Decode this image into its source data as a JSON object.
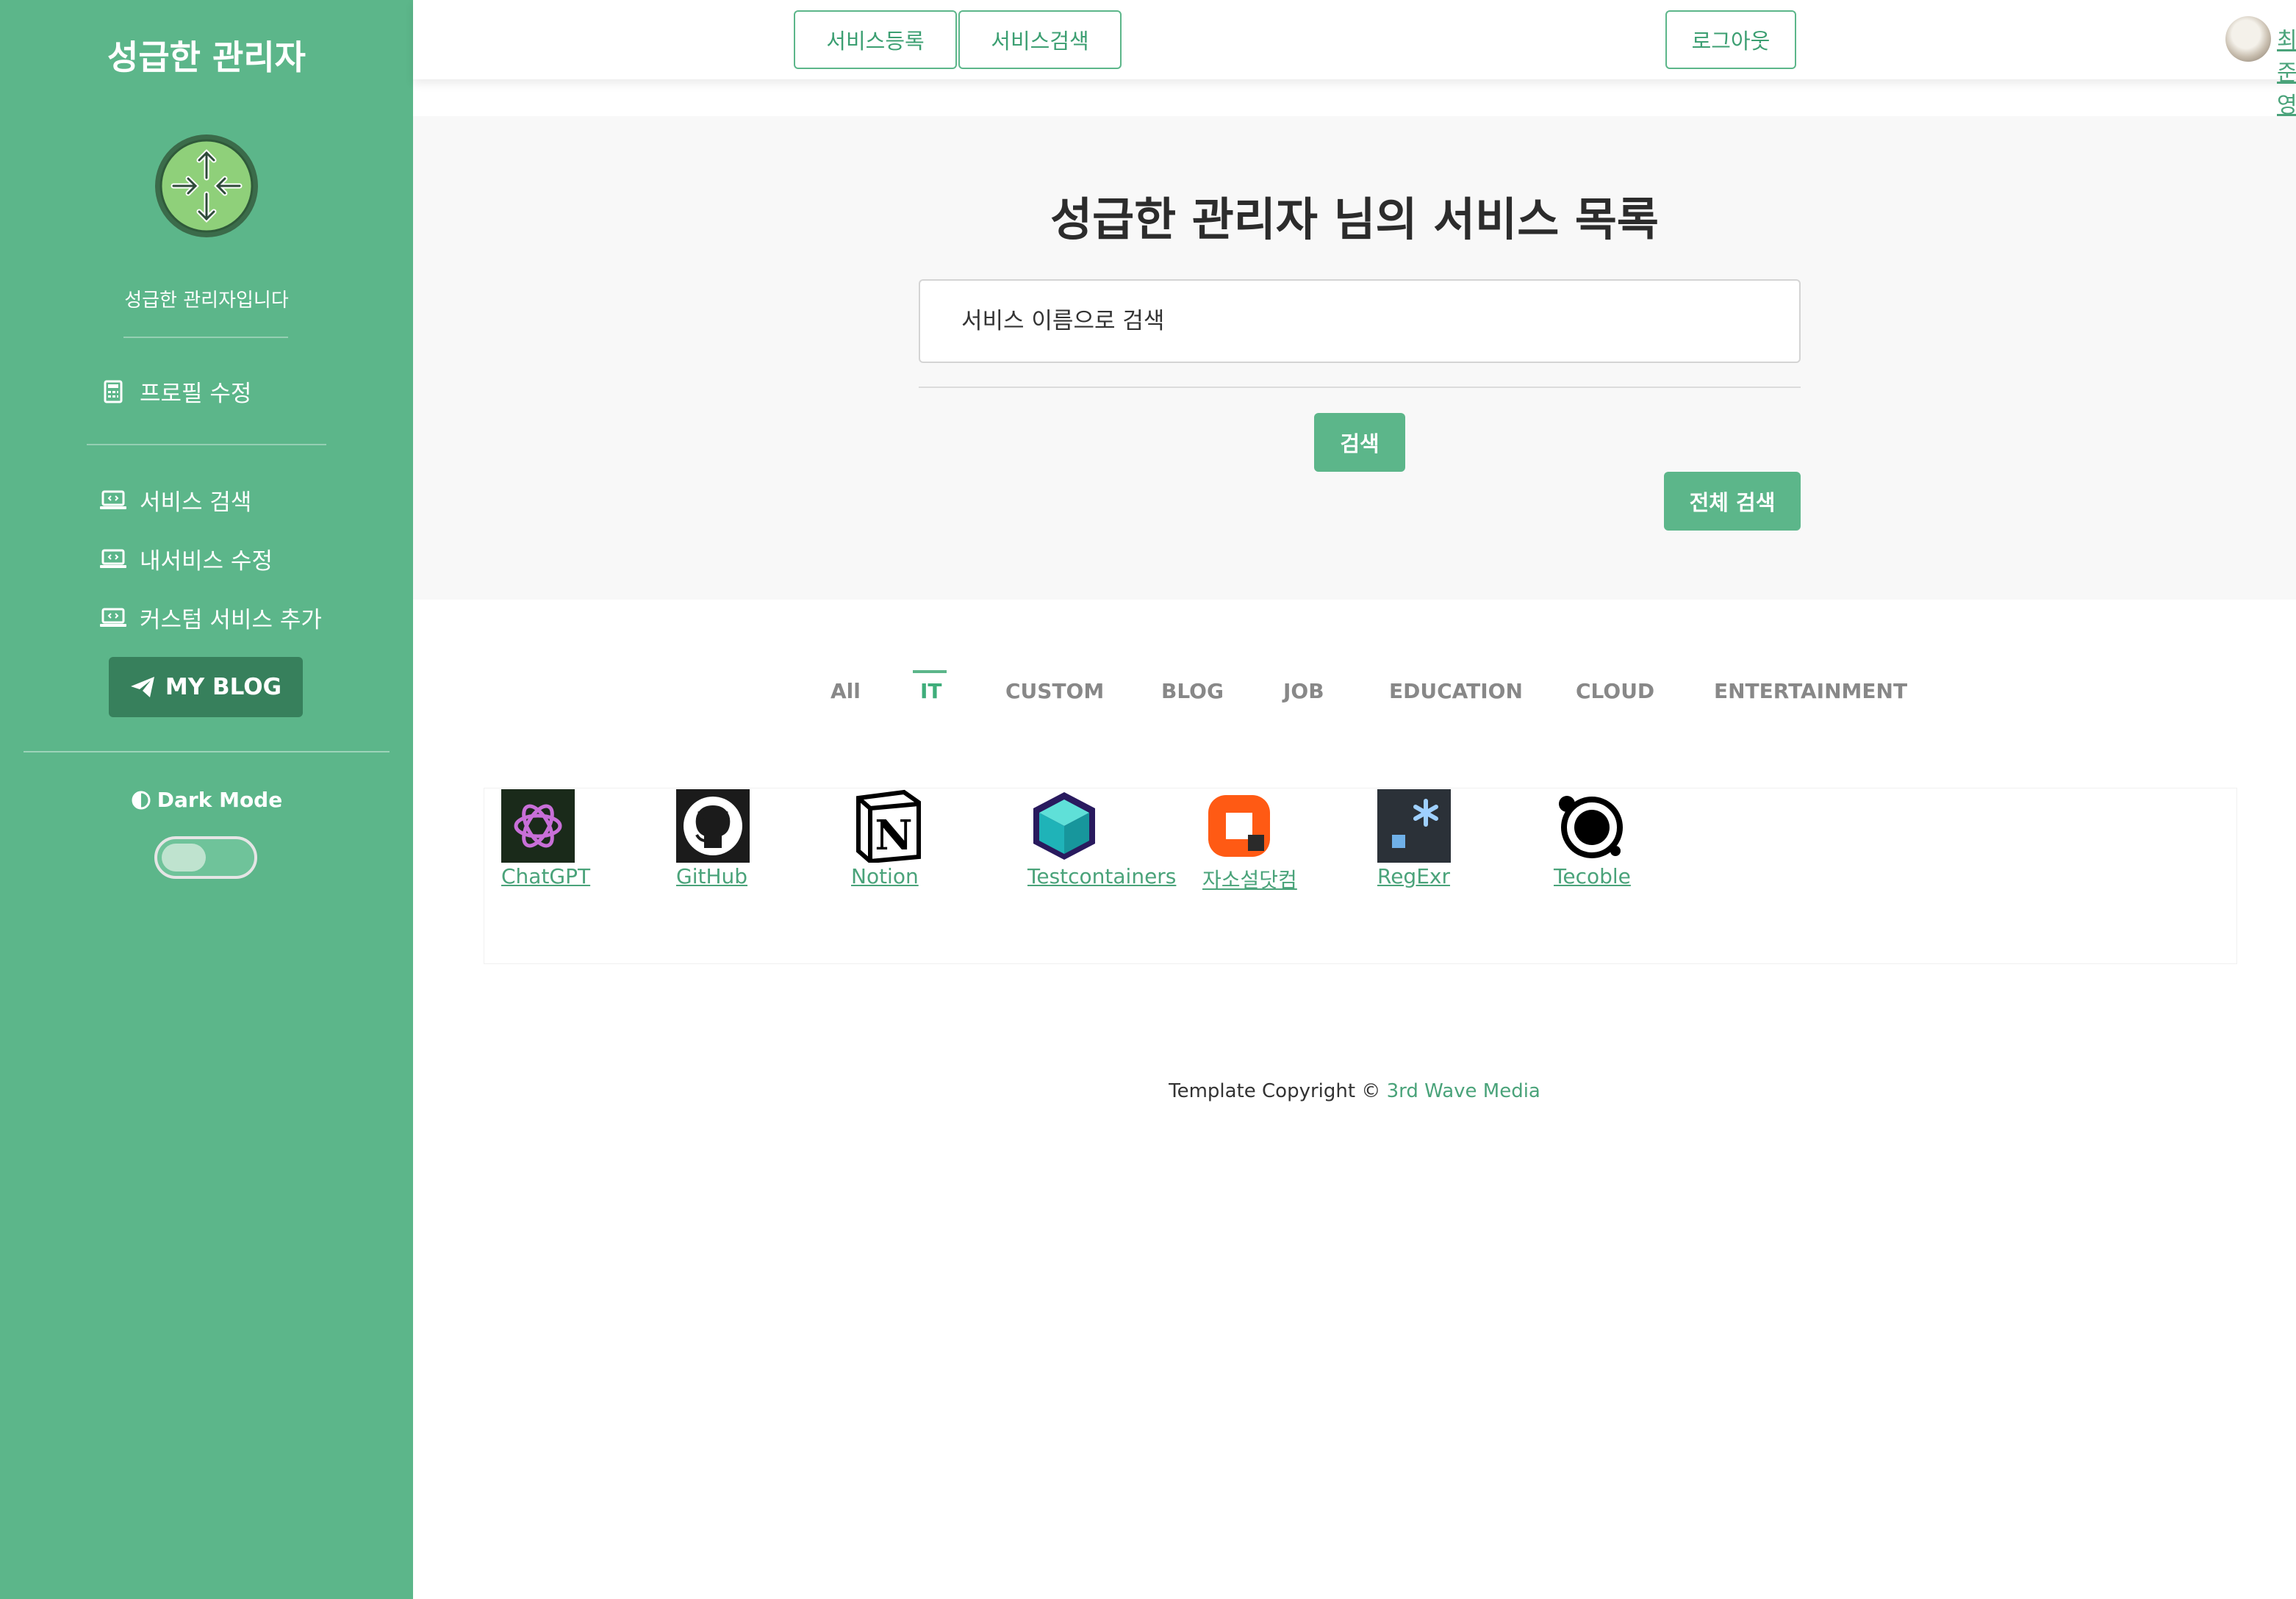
{
  "sidebar": {
    "title": "성급한 관리자",
    "tagline": "성급한 관리자입니다",
    "profile_edit": "프로필 수정",
    "nav": [
      "서비스 검색",
      "내서비스 수정",
      "커스텀 서비스 추가"
    ],
    "blog_button": "MY BLOG",
    "dark_mode_label": "Dark Mode",
    "dark_mode_on": false
  },
  "header": {
    "register_button": "서비스등록",
    "search_button": "서비스검색",
    "logout_button": "로그아웃",
    "username": "최준영"
  },
  "hero": {
    "title": "성급한 관리자 님의 서비스 목록",
    "search_placeholder": "서비스 이름으로 검색",
    "search_button": "검색",
    "search_all_button": "전체 검색"
  },
  "tabs": {
    "items": [
      "All",
      "IT",
      "CUSTOM",
      "BLOG",
      "JOB",
      "EDUCATION",
      "CLOUD",
      "ENTERTAINMENT"
    ],
    "active": "IT"
  },
  "services": [
    {
      "name": "ChatGPT",
      "icon": "chatgpt-icon"
    },
    {
      "name": "GitHub",
      "icon": "github-icon"
    },
    {
      "name": "Notion",
      "icon": "notion-icon"
    },
    {
      "name": "Testcontainers",
      "icon": "testcontainers-icon"
    },
    {
      "name": "자소설닷컴",
      "icon": "jasoseol-icon"
    },
    {
      "name": "RegExr",
      "icon": "regexr-icon"
    },
    {
      "name": "Tecoble",
      "icon": "tecoble-icon"
    }
  ],
  "footer": {
    "text": "Template Copyright © ",
    "link": "3rd Wave Media"
  },
  "colors": {
    "sidebar": "#5cb68a",
    "accent": "#3fae7b",
    "blog_button": "#37805c"
  }
}
